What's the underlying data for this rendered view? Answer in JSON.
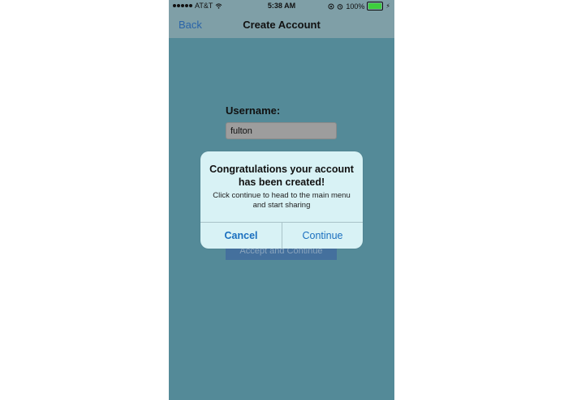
{
  "status_bar": {
    "carrier": "AT&T",
    "time": "5:38 AM",
    "battery_percent": "100%",
    "battery_level": 1.0,
    "icons": [
      "signal-icon",
      "wifi-icon",
      "orientation-lock-icon",
      "alarm-icon",
      "battery-icon",
      "charging-icon"
    ]
  },
  "nav": {
    "back_label": "Back",
    "title": "Create Account"
  },
  "form": {
    "username_label": "Username:",
    "username_value": "fulton",
    "accept_label": "Accept and Continue"
  },
  "alert": {
    "title": "Congratulations your account has been created!",
    "message": "Click continue to head to the main menu and start sharing",
    "cancel_label": "Cancel",
    "continue_label": "Continue"
  },
  "colors": {
    "background": "#548a98",
    "bar": "#7f9fa7",
    "link": "#2a64a8",
    "alert_bg": "#d8f2f5",
    "alert_button": "#1a6fbf",
    "battery": "#3dce3d"
  }
}
